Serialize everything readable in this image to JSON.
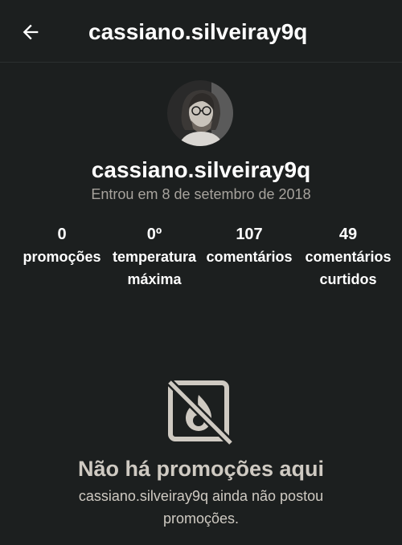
{
  "header": {
    "back_icon": "arrow-left-icon",
    "title": "cassiano.silveiray9q"
  },
  "profile": {
    "avatar_icon": "user-avatar-photo",
    "name": "cassiano.silveiray9q",
    "joined": "Entrou em 8 de setembro de 2018"
  },
  "stats": [
    {
      "value": "0",
      "label": "promoções"
    },
    {
      "value": "0º",
      "label": "temperatura\nmáxima"
    },
    {
      "value": "107",
      "label": "comentários"
    },
    {
      "value": "49",
      "label": "comentários\ncurtidos"
    }
  ],
  "empty_state": {
    "icon": "no-promotions-icon",
    "title": "Não há promoções aqui",
    "subtitle": "cassiano.silveiray9q ainda não postou promoções."
  },
  "colors": {
    "background": "#1c1f1f",
    "text_primary": "#ffffff",
    "text_secondary": "#a7a39d",
    "empty_state_text": "#cfcac2"
  }
}
